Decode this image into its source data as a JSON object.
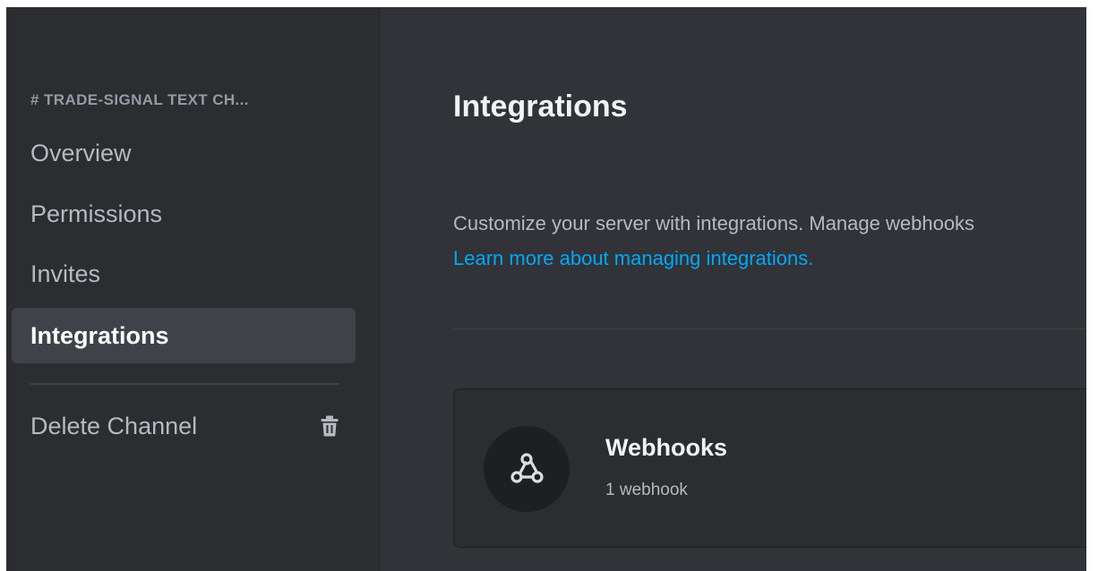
{
  "sidebar": {
    "category": "# TRADE-SIGNAL  TEXT CH...",
    "items": [
      {
        "label": "Overview",
        "selected": false
      },
      {
        "label": "Permissions",
        "selected": false
      },
      {
        "label": "Invites",
        "selected": false
      },
      {
        "label": "Integrations",
        "selected": true
      }
    ],
    "delete_label": "Delete Channel",
    "delete_icon": "trash-icon"
  },
  "main": {
    "title": "Integrations",
    "description": "Customize your server with integrations. Manage webhooks",
    "learn_more": "Learn more about managing integrations.",
    "webhooks_card": {
      "icon": "webhook-icon",
      "title": "Webhooks",
      "subtitle": "1 webhook"
    }
  },
  "colors": {
    "sidebar_bg": "#2b2d31",
    "main_bg": "#313338",
    "selected_bg": "#404249",
    "link": "#00a8fc",
    "card_bg": "#2b2d31",
    "icon_circle": "#1e1f22"
  }
}
